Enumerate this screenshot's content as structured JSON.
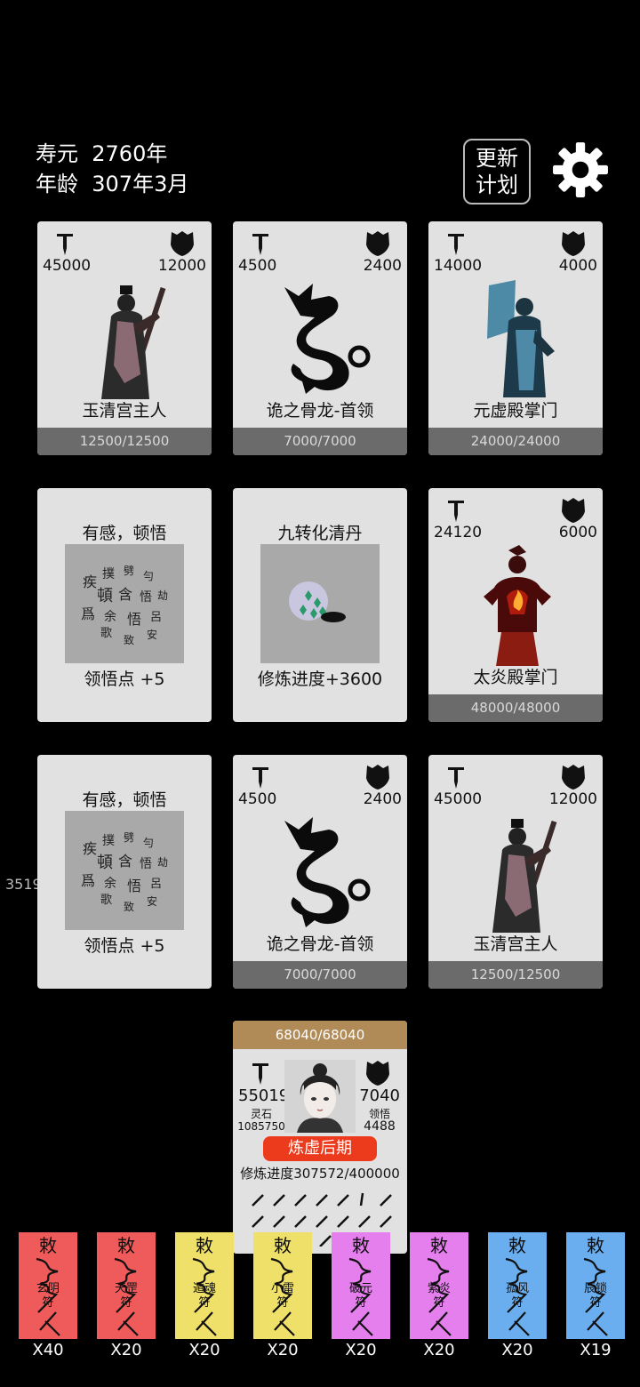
{
  "header": {
    "lifespan_label": "寿元",
    "lifespan_value": "2760年",
    "age_label": "年龄",
    "age_value": "307年3月",
    "update_button_line1": "更新",
    "update_button_line2": "计划"
  },
  "side_number": "3519",
  "cards": [
    {
      "kind": "enemy",
      "name": "玉清宫主人",
      "atk": "45000",
      "def": "12000",
      "hp": "12500/12500",
      "portrait": "sage-with-staff"
    },
    {
      "kind": "enemy",
      "name": "诡之骨龙-首领",
      "atk": "4500",
      "def": "2400",
      "hp": "7000/7000",
      "portrait": "bone-dragon"
    },
    {
      "kind": "enemy",
      "name": "元虚殿掌门",
      "atk": "14000",
      "def": "4000",
      "hp": "24000/24000",
      "portrait": "blue-fan-master"
    },
    {
      "kind": "event",
      "title": "有感，顿悟",
      "desc": "领悟点  +5",
      "image": "calligraphy-scroll"
    },
    {
      "kind": "event",
      "title": "九转化清丹",
      "desc": "修炼进度+3600",
      "image": "pill-bowl"
    },
    {
      "kind": "enemy",
      "name": "太炎殿掌门",
      "atk": "24120",
      "def": "6000",
      "hp": "48000/48000",
      "portrait": "flame-master"
    },
    {
      "kind": "event",
      "title": "有感，顿悟",
      "desc": "领悟点  +5",
      "image": "calligraphy-scroll"
    },
    {
      "kind": "enemy",
      "name": "诡之骨龙-首领",
      "atk": "4500",
      "def": "2400",
      "hp": "7000/7000",
      "portrait": "bone-dragon"
    },
    {
      "kind": "enemy",
      "name": "玉清宫主人",
      "atk": "45000",
      "def": "12000",
      "hp": "12500/12500",
      "portrait": "sage-with-staff"
    }
  ],
  "player": {
    "hp": "68040/68040",
    "atk": "55019",
    "def": "7040",
    "spirit_stone_label": "灵石",
    "spirit_stone_value": "1085750",
    "insight_label": "领悟",
    "insight_value": "4488",
    "realm": "炼虚后期",
    "progress_label": "修炼进度",
    "progress_value": "307572/400000"
  },
  "talismans": [
    {
      "name": "玄阴符",
      "count": "X40",
      "color": "#ef5a5a"
    },
    {
      "name": "天罡符",
      "count": "X20",
      "color": "#ef5a5a"
    },
    {
      "name": "遁魂符",
      "count": "X20",
      "color": "#efe06a"
    },
    {
      "name": "小雷符",
      "count": "X20",
      "color": "#efe06a"
    },
    {
      "name": "破元符",
      "count": "X20",
      "color": "#e57fee"
    },
    {
      "name": "紫炎符",
      "count": "X20",
      "color": "#e57fee"
    },
    {
      "name": "孤风符",
      "count": "X20",
      "color": "#6aaef0"
    },
    {
      "name": "辰锁符",
      "count": "X19",
      "color": "#6aaef0"
    }
  ]
}
